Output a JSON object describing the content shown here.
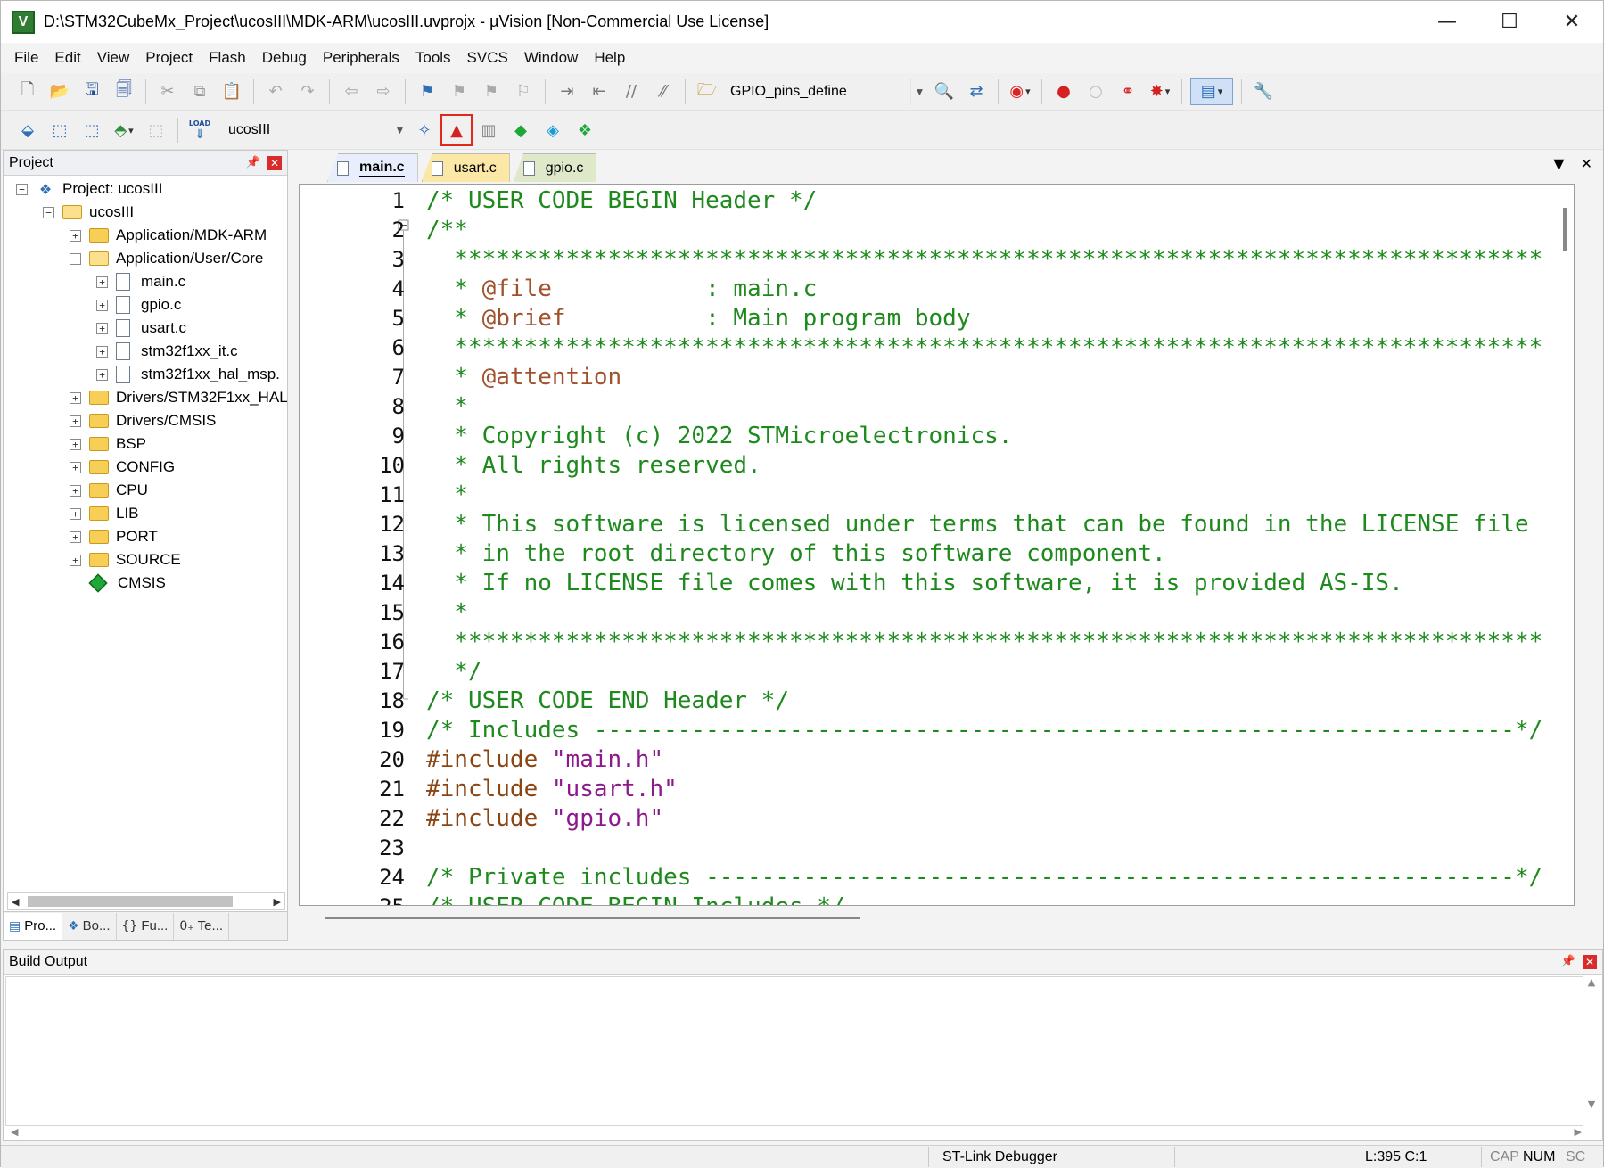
{
  "window": {
    "title": "D:\\STM32CubeMx_Project\\ucosIII\\MDK-ARM\\ucosIII.uvprojx - µVision  [Non-Commercial Use License]",
    "app_icon_letter": "V",
    "minimize": "—",
    "maximize": "☐",
    "close": "✕"
  },
  "menu": [
    "File",
    "Edit",
    "View",
    "Project",
    "Flash",
    "Debug",
    "Peripherals",
    "Tools",
    "SVCS",
    "Window",
    "Help"
  ],
  "toolbar1": {
    "find_combo_value": "GPIO_pins_define"
  },
  "toolbar2": {
    "target_combo_value": "ucosIII",
    "load_label": "LOAD"
  },
  "project_panel": {
    "title": "Project",
    "tree": [
      {
        "label": "Project: ucosIII",
        "kind": "project"
      },
      {
        "label": "ucosIII",
        "kind": "target"
      },
      {
        "label": "Application/MDK-ARM",
        "kind": "folder"
      },
      {
        "label": "Application/User/Core",
        "kind": "folder-open"
      },
      {
        "label": "main.c",
        "kind": "file"
      },
      {
        "label": "gpio.c",
        "kind": "file"
      },
      {
        "label": "usart.c",
        "kind": "file"
      },
      {
        "label": "stm32f1xx_it.c",
        "kind": "file"
      },
      {
        "label": "stm32f1xx_hal_msp.",
        "kind": "file"
      },
      {
        "label": "Drivers/STM32F1xx_HAL",
        "kind": "folder"
      },
      {
        "label": "Drivers/CMSIS",
        "kind": "folder"
      },
      {
        "label": "BSP",
        "kind": "folder"
      },
      {
        "label": "CONFIG",
        "kind": "folder"
      },
      {
        "label": "CPU",
        "kind": "folder"
      },
      {
        "label": "LIB",
        "kind": "folder"
      },
      {
        "label": "PORT",
        "kind": "folder"
      },
      {
        "label": "SOURCE",
        "kind": "folder"
      },
      {
        "label": "CMSIS",
        "kind": "cmsis"
      }
    ],
    "tabs": [
      "Pro...",
      "Bo...",
      "Fu...",
      "Te..."
    ]
  },
  "editor": {
    "tabs": [
      "main.c",
      "usart.c",
      "gpio.c"
    ],
    "active_tab": "main.c",
    "lines": [
      {
        "n": "1",
        "text": "/* USER CODE BEGIN Header */",
        "type": "com"
      },
      {
        "n": "2",
        "text": "/**",
        "type": "com"
      },
      {
        "n": "3",
        "text": "  ******************************************************************************",
        "type": "com"
      },
      {
        "n": "4",
        "text": "  * @file           : main.c",
        "type": "com"
      },
      {
        "n": "5",
        "text": "  * @brief          : Main program body",
        "type": "com"
      },
      {
        "n": "6",
        "text": "  ******************************************************************************",
        "type": "com"
      },
      {
        "n": "7",
        "text": "  * @attention",
        "type": "com"
      },
      {
        "n": "8",
        "text": "  *",
        "type": "com"
      },
      {
        "n": "9",
        "text": "  * Copyright (c) 2022 STMicroelectronics.",
        "type": "com"
      },
      {
        "n": "10",
        "text": "  * All rights reserved.",
        "type": "com"
      },
      {
        "n": "11",
        "text": "  *",
        "type": "com"
      },
      {
        "n": "12",
        "text": "  * This software is licensed under terms that can be found in the LICENSE file",
        "type": "com"
      },
      {
        "n": "13",
        "text": "  * in the root directory of this software component.",
        "type": "com"
      },
      {
        "n": "14",
        "text": "  * If no LICENSE file comes with this software, it is provided AS-IS.",
        "type": "com"
      },
      {
        "n": "15",
        "text": "  *",
        "type": "com"
      },
      {
        "n": "16",
        "text": "  ******************************************************************************",
        "type": "com"
      },
      {
        "n": "17",
        "text": "  */",
        "type": "com"
      },
      {
        "n": "18",
        "text": "/* USER CODE END Header */",
        "type": "com"
      },
      {
        "n": "19",
        "text": "/* Includes ------------------------------------------------------------------*/",
        "type": "com"
      },
      {
        "n": "20",
        "text": "#include \"main.h\"",
        "type": "inc"
      },
      {
        "n": "21",
        "text": "#include \"usart.h\"",
        "type": "inc"
      },
      {
        "n": "22",
        "text": "#include \"gpio.h\"",
        "type": "inc"
      },
      {
        "n": "23",
        "text": "",
        "type": "com"
      },
      {
        "n": "24",
        "text": "/* Private includes ----------------------------------------------------------*/",
        "type": "com"
      },
      {
        "n": "25",
        "text": "/* USER CODE BEGIN Includes */",
        "type": "com"
      }
    ]
  },
  "build_output": {
    "title": "Build Output"
  },
  "status": {
    "debugger": "ST-Link Debugger",
    "cursor": "L:395 C:1",
    "cap": "CAP",
    "num": "NUM",
    "scrl": "SC"
  }
}
